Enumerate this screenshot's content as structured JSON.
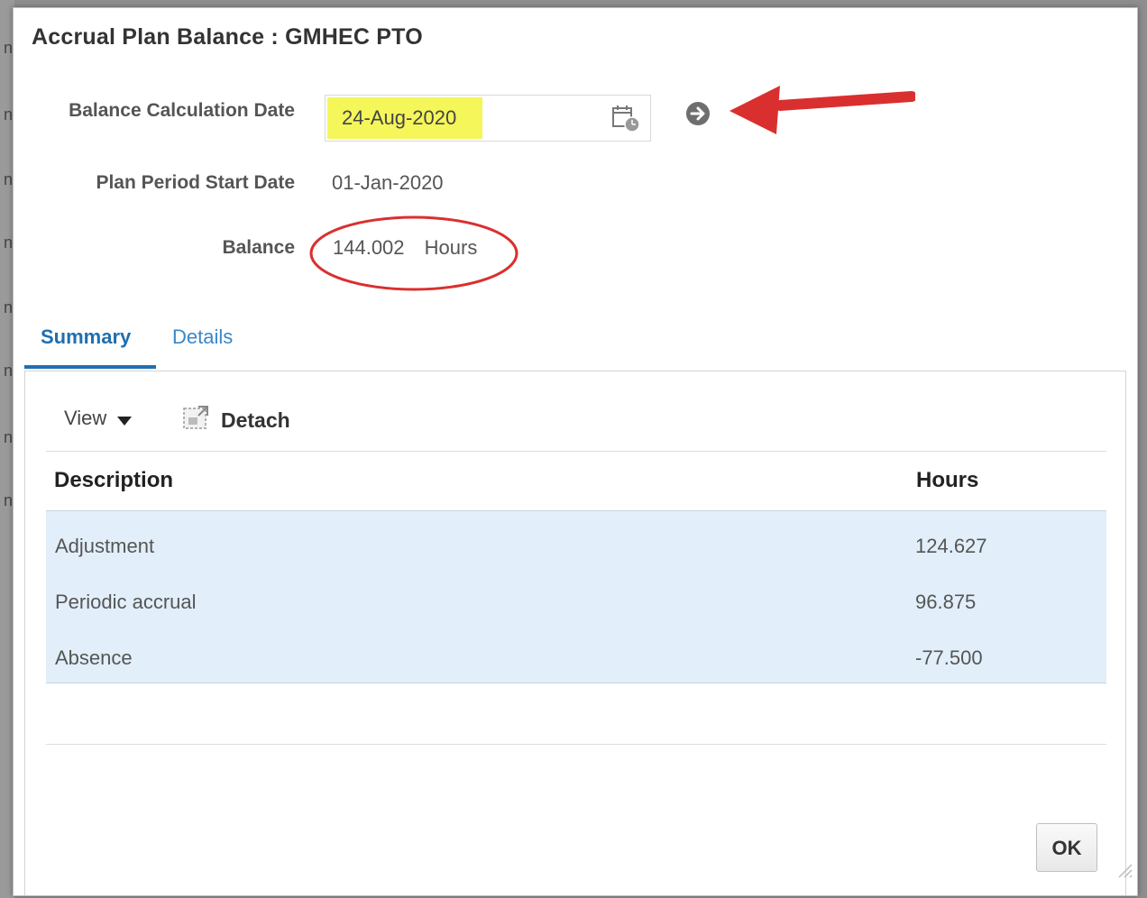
{
  "dialog": {
    "title": "Accrual Plan Balance : GMHEC PTO",
    "fields": {
      "balance_calc_date_label": "Balance Calculation Date",
      "balance_calc_date_value": "24-Aug-2020",
      "plan_start_label": "Plan Period Start Date",
      "plan_start_value": "01-Jan-2020",
      "balance_label": "Balance",
      "balance_value": "144.002",
      "balance_unit": "Hours"
    },
    "tabs": [
      {
        "label": "Summary",
        "active": true
      },
      {
        "label": "Details",
        "active": false
      }
    ],
    "toolbar": {
      "view_label": "View",
      "detach_label": "Detach"
    },
    "table": {
      "columns": [
        "Description",
        "Hours"
      ],
      "rows": [
        {
          "description": "Adjustment",
          "hours": "124.627"
        },
        {
          "description": "Periodic accrual",
          "hours": "96.875"
        },
        {
          "description": "Absence",
          "hours": "-77.500"
        }
      ]
    },
    "ok_label": "OK"
  },
  "colors": {
    "accent": "#1f6fb0",
    "highlight": "#f4f65a",
    "row_bg": "#e2effa",
    "annotation": "#d9302f"
  },
  "icons": [
    "calendar-icon",
    "go-arrow-icon",
    "detach-icon",
    "caret-down-icon",
    "resize-handle-icon"
  ]
}
